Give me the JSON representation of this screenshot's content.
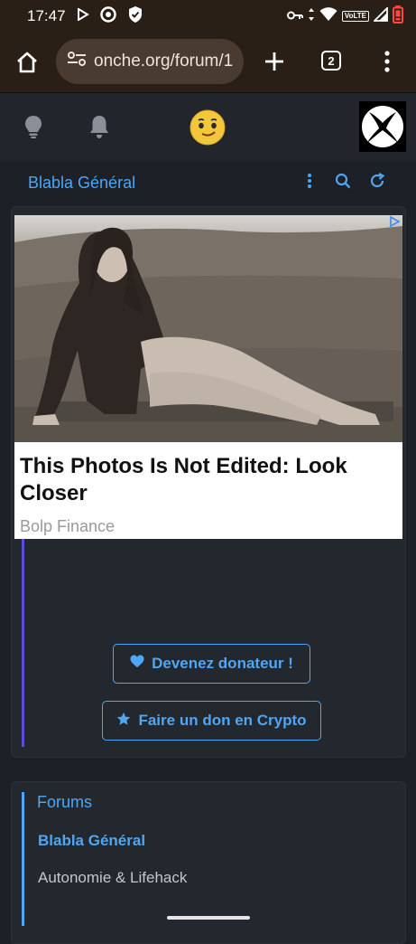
{
  "status_bar": {
    "time": "17:47",
    "network_label": "VoLTE",
    "icons": [
      "play-store-icon",
      "chrome-icon",
      "shield-icon",
      "key-icon",
      "data-arrows-icon",
      "wifi-icon",
      "signal-icon",
      "battery-low-icon"
    ]
  },
  "browser": {
    "url": "onche.org/forum/1",
    "tab_count": "2",
    "icons": [
      "home-icon",
      "site-settings-icon",
      "new-tab-icon",
      "tabs-icon",
      "more-vert-icon"
    ]
  },
  "site_header": {
    "icons": [
      "lightbulb-icon",
      "bell-icon",
      "emoji-icon"
    ],
    "avatar": "xbox-logo-avatar"
  },
  "forum_bar": {
    "title": "Blabla Général",
    "icons": [
      "more-vert-icon",
      "search-icon",
      "refresh-icon"
    ]
  },
  "ad": {
    "headline": "This Photos Is Not Edited: Look Closer",
    "source": "Bolp Finance",
    "badge_icon": "adchoices-icon"
  },
  "donate": {
    "donor_label": "Devenez donateur !",
    "crypto_label": "Faire un don en Crypto",
    "donor_icon": "heart-icon",
    "crypto_icon": "star-icon"
  },
  "forums": {
    "heading": "Forums",
    "items": [
      {
        "label": "Blabla Général",
        "active": true
      },
      {
        "label": "Autonomie & Lifehack",
        "active": false
      }
    ]
  },
  "colors": {
    "accent": "#4ea6f5",
    "background": "#1d2027",
    "card": "#23272e",
    "purple_bar": "#5a4ed6"
  }
}
